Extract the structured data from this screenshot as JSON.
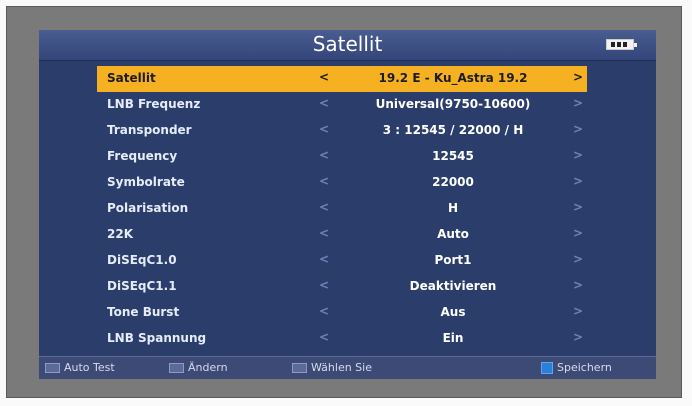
{
  "screen": {
    "title": "Satellit"
  },
  "menu": [
    {
      "label": "Satellit",
      "value": "19.2 E - Ku_Astra 19.2",
      "selected": true
    },
    {
      "label": "LNB Frequenz",
      "value": "Universal(9750-10600)"
    },
    {
      "label": "Transponder",
      "value": "3 : 12545 / 22000 / H"
    },
    {
      "label": "Frequency",
      "value": "12545"
    },
    {
      "label": "Symbolrate",
      "value": "22000"
    },
    {
      "label": "Polarisation",
      "value": "H"
    },
    {
      "label": "22K",
      "value": "Auto"
    },
    {
      "label": "DiSEqC1.0",
      "value": "Port1"
    },
    {
      "label": "DiSEqC1.1",
      "value": "Deaktivieren"
    },
    {
      "label": "Tone Burst",
      "value": "Aus"
    },
    {
      "label": "LNB Spannung",
      "value": "Ein"
    }
  ],
  "arrows": {
    "left": "<",
    "right": ">"
  },
  "footer": {
    "auto_test": "Auto Test",
    "andern": "Ändern",
    "wahlen": "Wählen Sie",
    "speichern": "Speichern"
  },
  "icons": {
    "battery": "battery-icon",
    "save": "blue-square-icon"
  },
  "colors": {
    "screen_bg": "#2b3d6b",
    "highlight": "#f5b122",
    "bezel": "#7a7a7a"
  }
}
